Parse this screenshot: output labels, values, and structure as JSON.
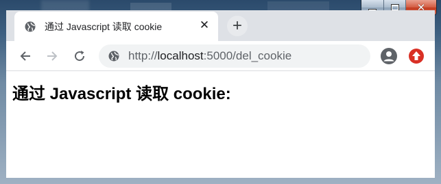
{
  "tab": {
    "title": "通过 Javascript 读取 cookie"
  },
  "toolbar": {
    "url_scheme": "http://",
    "url_host": "localhost",
    "url_rest": ":5000/del_cookie"
  },
  "page": {
    "heading": "通过 Javascript 读取 cookie:"
  },
  "icons": {
    "tab_favicon": "globe-icon",
    "tab_close": "close-icon",
    "new_tab": "plus-icon",
    "back": "arrow-left-icon",
    "forward": "arrow-right-icon",
    "reload": "reload-icon",
    "site_info": "globe-icon",
    "profile": "account-circle-icon",
    "extension": "red-circle-up-arrow-icon"
  },
  "colors": {
    "accent_extension": "#d93025",
    "page_background": "#ffffff",
    "chrome_frame": "#dee1e6"
  }
}
